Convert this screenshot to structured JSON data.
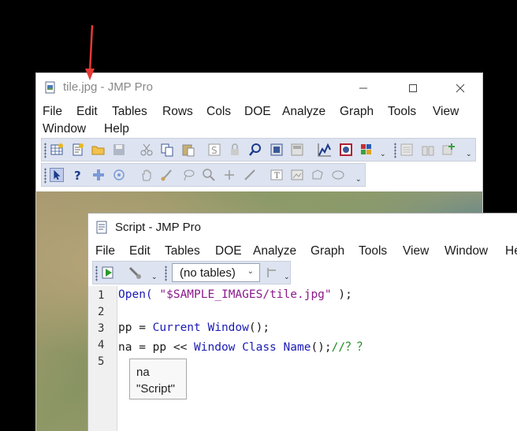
{
  "back_window": {
    "title": "tile.jpg - JMP Pro",
    "menu": [
      "File",
      "Edit",
      "Tables",
      "Rows",
      "Cols",
      "DOE",
      "Analyze",
      "Graph",
      "Tools",
      "View",
      "Window",
      "Help"
    ]
  },
  "script_window": {
    "title": "Script - JMP Pro",
    "menu": [
      "File",
      "Edit",
      "Tables",
      "DOE",
      "Analyze",
      "Graph",
      "Tools",
      "View",
      "Window",
      "He"
    ],
    "table_combo": "(no tables)",
    "line_numbers": [
      "1",
      "2",
      "3",
      "4",
      "5"
    ],
    "code": {
      "l1_fn": "Open(",
      "l1_str": "\"$SAMPLE_IMAGES/tile.jpg\"",
      "l1_end": " );",
      "l3_var": "pp = ",
      "l3_fn": "Current Window",
      "l3_end": "();",
      "l4_var": "na = pp << ",
      "l4_fn": "Window Class Name",
      "l4_end": "();",
      "l4_cmt": "//？？"
    },
    "output": {
      "name": "na",
      "value": "\"Script\""
    }
  },
  "annotation": {
    "arrow_color": "#e53935"
  }
}
